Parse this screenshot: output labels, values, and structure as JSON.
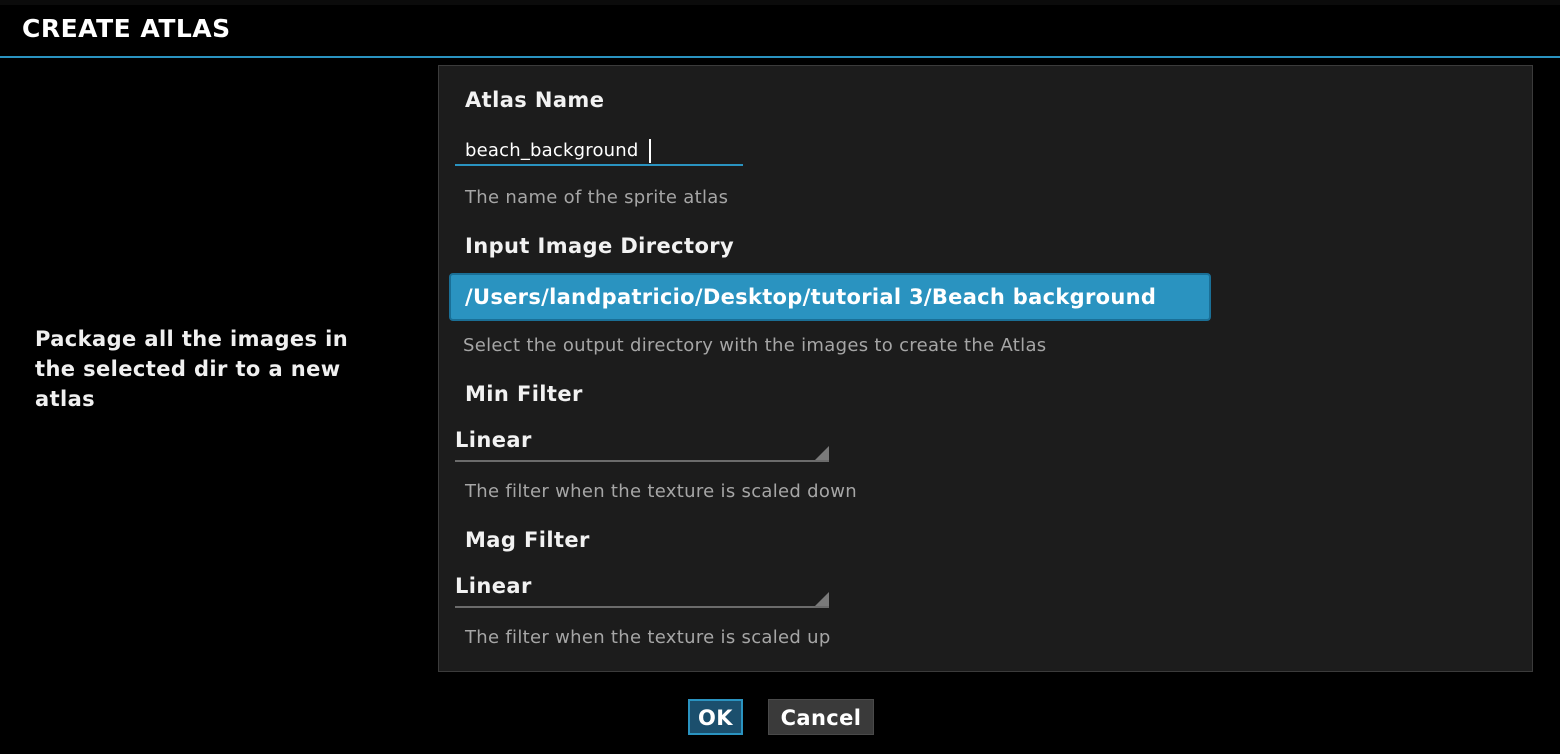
{
  "dialog": {
    "title": "CREATE ATLAS",
    "description": "Package all the images in the selected dir to a new atlas"
  },
  "fields": {
    "atlas_name": {
      "label": "Atlas Name",
      "value": "beach_background",
      "hint": "The name of the sprite atlas"
    },
    "input_dir": {
      "label": "Input Image Directory",
      "value": "/Users/landpatricio/Desktop/tutorial 3/Beach background",
      "hint": "Select the output directory with the images to create the Atlas"
    },
    "min_filter": {
      "label": "Min Filter",
      "value": "Linear",
      "hint": "The filter when the texture is scaled down"
    },
    "mag_filter": {
      "label": "Mag Filter",
      "value": "Linear",
      "hint": "The filter when the texture is scaled up"
    }
  },
  "buttons": {
    "ok_label": "OK",
    "cancel_label": "Cancel"
  },
  "colors": {
    "accent": "#2a93c0",
    "panel": "#1c1c1c",
    "background": "#000000"
  }
}
